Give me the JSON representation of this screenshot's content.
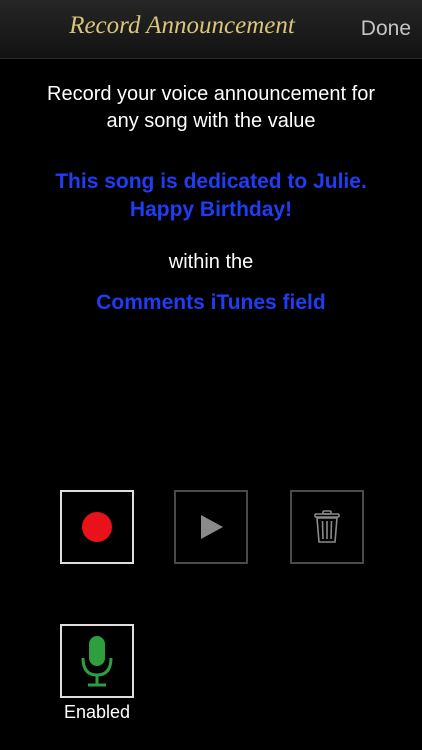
{
  "navbar": {
    "title": "Record Announcement",
    "done_label": "Done"
  },
  "content": {
    "intro_line1": "Record your voice announcement for",
    "intro_line2": "any song with the value",
    "dedication_line1": "This song is dedicated to Julie.",
    "dedication_line2": "Happy Birthday!",
    "within_label": "within the",
    "field_name": "Comments iTunes field"
  },
  "controls": {
    "record": {
      "icon": "record-dot-icon",
      "state": "enabled"
    },
    "play": {
      "icon": "play-icon",
      "state": "disabled"
    },
    "delete": {
      "icon": "trash-icon",
      "state": "disabled"
    },
    "microphone": {
      "icon": "microphone-icon",
      "status_label": "Enabled"
    }
  },
  "colors": {
    "title_gold": "#d8c47a",
    "highlight_blue": "#1f3df5",
    "record_red": "#e8121b",
    "mic_green": "#2e9e3e"
  }
}
